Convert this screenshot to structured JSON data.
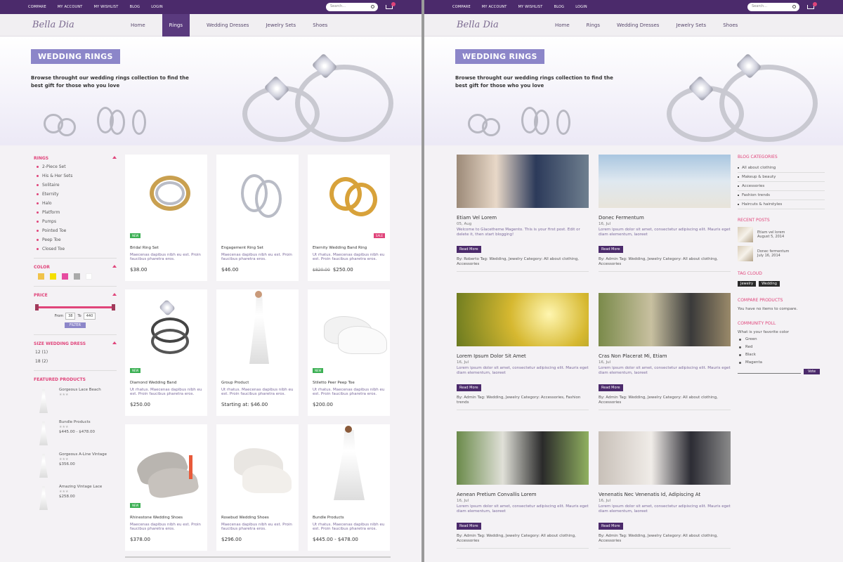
{
  "topbar": {
    "links": [
      "COMPARE",
      "MY ACCOUNT",
      "MY WISHLIST",
      "BLOG",
      "LOGIN"
    ],
    "search_placeholder": "Search..."
  },
  "nav": {
    "logo": "Bella Dia",
    "items": [
      "Home",
      "Rings",
      "Wedding Dresses",
      "Jewelry Sets",
      "Shoes"
    ]
  },
  "banner": {
    "title": "WEDDING RINGS",
    "text": "Browse throught  our wedding rings collection to find the best gift for those who you love"
  },
  "sidebar": {
    "rings_title": "RINGS",
    "rings": [
      "2-Piece Set",
      "His & Her Sets",
      "Solitaire",
      "Eternity",
      "Halo",
      "Platform",
      "Pumps",
      "Pointed Toe",
      "Peep Toe",
      "Closed Toe"
    ],
    "color_title": "COLOR",
    "colors": [
      "#f0c34a",
      "#f5e000",
      "#e64ca0",
      "#aaaaaa",
      "#ffffff"
    ],
    "price_title": "PRICE",
    "from_label": "From",
    "from_value": "38",
    "to_label": "To",
    "to_value": "440",
    "filter": "FILTER",
    "size_title": "SIZE WEDDING DRESS",
    "sizes": [
      "12 (1)",
      "18 (2)"
    ],
    "featured_title": "FEATURED PRODUCTS",
    "featured": [
      {
        "name": "Gorgeous Lace Beach",
        "stars": "★★★",
        "price": ""
      },
      {
        "name": "Bundle Products",
        "stars": "★★★",
        "price": "$445.00 - $478.00"
      },
      {
        "name": "Gorgeous A-Line Vintage",
        "stars": "★★★",
        "price": "$356.00"
      },
      {
        "name": "Amazing Vintage Lace",
        "stars": "★★★",
        "price": "$258.00"
      }
    ]
  },
  "products": [
    {
      "name": "Bridal Ring Set",
      "desc": "Maecenas dapibus nibh eu est. Proin faucibus pharetra eros.",
      "price": "$38.00",
      "old": "",
      "badge": "NEW",
      "badge_type": "new"
    },
    {
      "name": "Engagement Ring Set",
      "desc": "Maecenas dapibus nibh eu est. Proin faucibus pharetra eros.",
      "price": "$46.00",
      "old": "",
      "badge": "",
      "badge_type": ""
    },
    {
      "name": "Eternity Wedding Band Ring",
      "desc": "Ut rhatus. Maecenas dapibus nibh eu est. Proin faucibus pharetra eros.",
      "price": "$250.00",
      "old": "$820.00",
      "badge": "SALE",
      "badge_type": "sale"
    },
    {
      "name": "Diamond Wedding Band",
      "desc": "Ut rhatus. Maecenas dapibus nibh eu est. Proin faucibus pharetra eros.",
      "price": "$250.00",
      "old": "",
      "badge": "NEW",
      "badge_type": "new"
    },
    {
      "name": "Group Product",
      "desc": "Ut rhatus. Maecenas dapibus nibh eu est. Proin faucibus pharetra eros.",
      "price": "Starting at: $46.00",
      "old": "",
      "badge": "",
      "badge_type": ""
    },
    {
      "name": "Stiletto Peer Peep Toe",
      "desc": "Ut rhatus. Maecenas dapibus nibh eu est. Proin faucibus pharetra eros.",
      "price": "$200.00",
      "old": "",
      "badge": "NEW",
      "badge_type": "new"
    },
    {
      "name": "Rhinestone Wedding Shoes",
      "desc": "Maecenas dapibus nibh eu est. Proin faucibus pharetra eros.",
      "price": "$378.00",
      "old": "",
      "badge": "NEW",
      "badge_type": "new"
    },
    {
      "name": "Rosebud Wedding Shoes",
      "desc": "Maecenas dapibus nibh eu est. Proin faucibus pharetra eros.",
      "price": "$296.00",
      "old": "",
      "badge": "",
      "badge_type": ""
    },
    {
      "name": "Bundle Products",
      "desc": "Ut rhatus. Maecenas dapibus nibh eu est. Proin faucibus pharetra eros.",
      "price": "$445.00 - $478.00",
      "old": "",
      "badge": "",
      "badge_type": ""
    }
  ],
  "posts": [
    {
      "title": "Etiam Vel Lorem",
      "date": "05, Aug",
      "excerpt": "Welcome to Glacetheme Magento. This is your first post. Edit or delete it, then start blogging!",
      "read": "Read More",
      "meta": "By: Roberto   Tag: Wedding, Jewelry   Category: All about clothing, Accessories"
    },
    {
      "title": "Donec Fermentum",
      "date": "16, Jul",
      "excerpt": "Lorem ipsum dolor sit amet, consectetur adipiscing elit. Mauris eget diam elementum, laoreet",
      "read": "Read More",
      "meta": "By: Admin   Tag: Wedding, Jewelry   Category: All about clothing, Accessories"
    },
    {
      "title": "Lorem Ipsum Dolor Sit Amet",
      "date": "16, Jul",
      "excerpt": "Lorem ipsum dolor sit amet, consectetur adipiscing elit. Mauris eget diam elementum, laoreet",
      "read": "Read More",
      "meta": "By: Admin   Tag: Wedding, Jewelry   Category: Accessories, Fashion trends"
    },
    {
      "title": "Cras Non Placerat Mi, Etiam",
      "date": "16, Jul",
      "excerpt": "Lorem ipsum dolor sit amet, consectetur adipiscing elit. Mauris eget diam elementum, laoreet",
      "read": "Read More",
      "meta": "By: Admin   Tag: Wedding, Jewelry   Category: All about clothing, Accessories"
    },
    {
      "title": "Aenean Pretium Convallis Lorem",
      "date": "16, Jul",
      "excerpt": "Lorem ipsum dolor sit amet, consectetur adipiscing elit. Mauris eget diam elementum, laoreet",
      "read": "Read More",
      "meta": "By: Admin   Tag: Wedding, Jewelry   Category: All about clothing, Accessories"
    },
    {
      "title": "Venenatis Nec Venenatis Id, Adipiscing At",
      "date": "16, Jul",
      "excerpt": "Lorem ipsum dolor sit amet, consectetur adipiscing elit. Mauris eget diam elementum, laoreet",
      "read": "Read More",
      "meta": "By: Admin   Tag: Wedding, Jewelry   Category: All about clothing, Accessories"
    }
  ],
  "rside": {
    "cat_title": "BLOG CATEGORIES",
    "cats": [
      "All about clothing",
      "Makeup & beauty",
      "Accessories",
      "Fashion trends",
      "Haircuts & hairstyles"
    ],
    "recent_title": "RECENT POSTS",
    "recent": [
      {
        "name": "Etiam vel lorem",
        "date": "August 5, 2014"
      },
      {
        "name": "Donec fermentum",
        "date": "July 16, 2014"
      }
    ],
    "tag_title": "TAG CLOUD",
    "tags": [
      "Jewelry",
      "Wedding"
    ],
    "compare_title": "COMPARE PRODUCTS",
    "compare_text": "You have no items to compare.",
    "poll_title": "COMMUNITY POLL",
    "poll_q": "What is your favorite color",
    "poll_opts": [
      "Green",
      "Red",
      "Black",
      "Magenta"
    ],
    "vote": "Vote"
  }
}
